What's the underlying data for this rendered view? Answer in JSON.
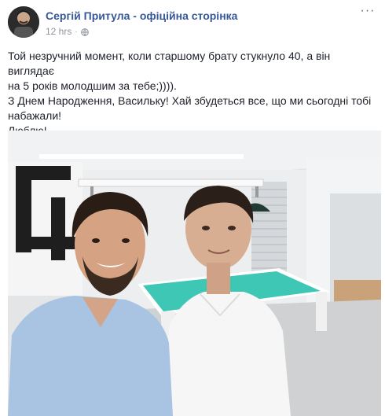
{
  "post": {
    "page_name": "Сергій Притула - офіційна сторінка",
    "time": "12 hrs",
    "separator": "·",
    "options_glyph": "···",
    "icons": {
      "avatar": "profile-avatar",
      "audience": "globe-icon",
      "options": "more-options-icon"
    },
    "text_lines": [
      "Той незручний момент, коли старшому брату стукнуло 40, а він виглядає",
      "на 5 років молодшим за тебе;)))).",
      "З Днем Народження, Васильку! Хай збудеться все, що ми сьогодні тобі",
      "набажали!",
      "Люблю!"
    ],
    "photo": {
      "description_icon": "photo-image"
    }
  },
  "colors": {
    "link": "#365899",
    "meta": "#90949c",
    "text": "#1d2129",
    "pool_table": "#3fc7b6"
  }
}
